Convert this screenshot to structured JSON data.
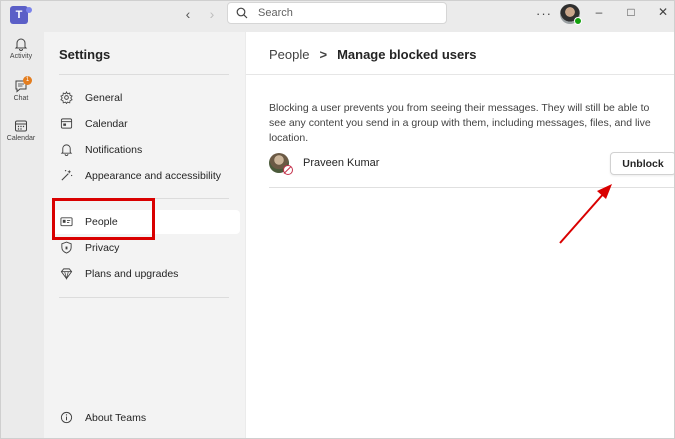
{
  "titlebar": {
    "logo_letter": "T",
    "search_placeholder": "Search",
    "more_label": "···"
  },
  "rail": {
    "items": [
      {
        "label": "Activity",
        "icon": "bell-icon"
      },
      {
        "label": "Chat",
        "icon": "chat-icon",
        "badge": "1"
      },
      {
        "label": "Calendar",
        "icon": "calendar-icon"
      }
    ]
  },
  "settings": {
    "title": "Settings",
    "items": [
      {
        "label": "General",
        "icon": "gear-icon"
      },
      {
        "label": "Calendar",
        "icon": "calendar-icon"
      },
      {
        "label": "Notifications",
        "icon": "bell-icon"
      },
      {
        "label": "Appearance and accessibility",
        "icon": "magic-wand-icon"
      },
      {
        "label": "People",
        "icon": "contact-card-icon",
        "active": true
      },
      {
        "label": "Privacy",
        "icon": "shield-icon"
      },
      {
        "label": "Plans and upgrades",
        "icon": "diamond-icon"
      }
    ],
    "about_label": "About Teams"
  },
  "main": {
    "breadcrumb_parent": "People",
    "breadcrumb_separator": ">",
    "breadcrumb_current": "Manage blocked users",
    "description": "Blocking a user prevents you from seeing their messages. They will still be able to see any content you send in a group with them, including messages, files, and live location.",
    "blocked_users": [
      {
        "name": "Praveen Kumar",
        "action_label": "Unblock"
      }
    ]
  },
  "colors": {
    "accent": "#5b5fc7",
    "highlight_red": "#d90000",
    "presence_green": "#13a10e",
    "badge_orange": "#e37d1f"
  }
}
